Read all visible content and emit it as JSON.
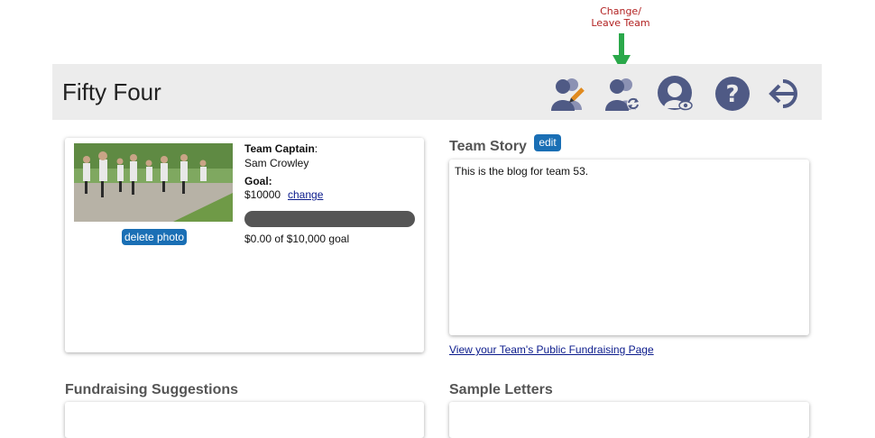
{
  "annotation": {
    "line1": "Change/",
    "line2": "Leave Team"
  },
  "header": {
    "team_name": "Fifty Four",
    "icons": [
      "edit-team-icon",
      "change-team-icon",
      "view-profile-icon",
      "help-icon",
      "logout-icon"
    ]
  },
  "team_card": {
    "delete_photo_label": "delete photo",
    "captain_label": "Team Captain",
    "captain_name": "Sam Crowley",
    "goal_label": "Goal:",
    "goal_value": "$10000",
    "change_label": "change",
    "progress_fraction": 0,
    "progress_text": "$0.00 of $10,000 goal"
  },
  "story": {
    "title": "Team Story",
    "edit_label": "edit",
    "text": "This is the blog for team 53."
  },
  "public_page_link": "View your Team's Public Fundraising Page",
  "sections": {
    "fundraising_title": "Fundraising Suggestions",
    "letters_title": "Sample Letters"
  },
  "colors": {
    "accent": "#1a6fb5",
    "icon": "#4f5a85",
    "annotation": "#b22222",
    "arrow": "#2aa84a"
  }
}
